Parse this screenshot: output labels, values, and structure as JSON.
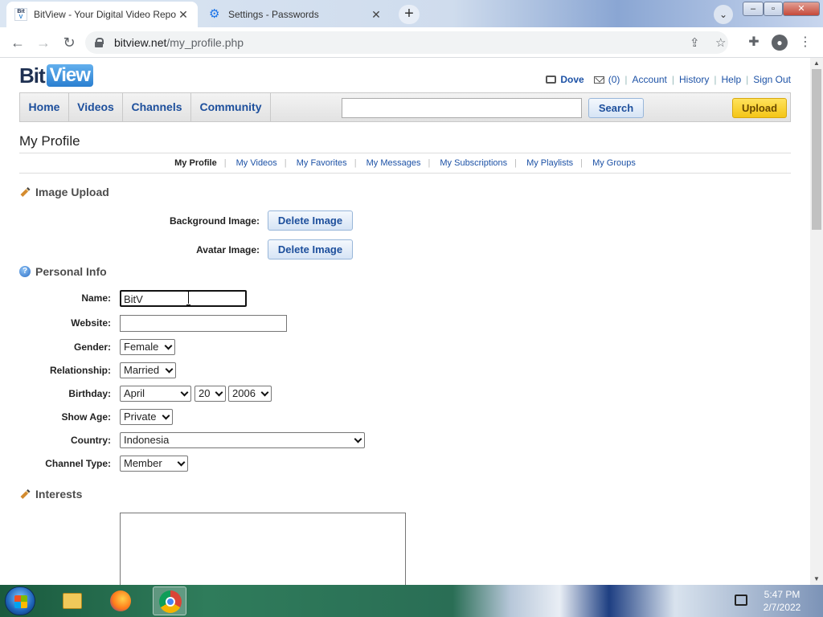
{
  "browser": {
    "tabs": [
      {
        "title": "BitView - Your Digital Video Repo",
        "favicon": "bitview-favicon"
      },
      {
        "title": "Settings - Passwords",
        "favicon": "gear-icon"
      }
    ],
    "url_host": "bitview.net",
    "url_path": "/my_profile.php"
  },
  "header": {
    "logo_bit": "Bit",
    "logo_view": "View",
    "username": "Dove",
    "messages": "(0)",
    "links": [
      "Account",
      "History",
      "Help",
      "Sign Out"
    ]
  },
  "nav": {
    "items": [
      "Home",
      "Videos",
      "Channels",
      "Community"
    ],
    "search_value": "",
    "search_label": "Search",
    "upload_label": "Upload"
  },
  "page": {
    "title": "My Profile",
    "subnav": [
      "My Profile",
      "My Videos",
      "My Favorites",
      "My Messages",
      "My Subscriptions",
      "My Playlists",
      "My Groups"
    ],
    "subnav_current": "My Profile"
  },
  "image_upload": {
    "heading": "Image Upload",
    "background_label": "Background Image:",
    "avatar_label": "Avatar Image:",
    "delete_label": "Delete Image"
  },
  "personal_info": {
    "heading": "Personal Info",
    "name_label": "Name:",
    "name_value": "BitV",
    "website_label": "Website:",
    "website_value": "",
    "gender_label": "Gender:",
    "gender_value": "Female",
    "relationship_label": "Relationship:",
    "relationship_value": "Married",
    "birthday_label": "Birthday:",
    "birthday_month": "April",
    "birthday_day": "20",
    "birthday_year": "2006",
    "show_age_label": "Show Age:",
    "show_age_value": "Private",
    "country_label": "Country:",
    "country_value": "Indonesia",
    "channel_type_label": "Channel Type:",
    "channel_type_value": "Member"
  },
  "interests": {
    "heading": "Interests",
    "value": ""
  },
  "taskbar": {
    "time": "5:47 PM",
    "date": "2/7/2022"
  }
}
